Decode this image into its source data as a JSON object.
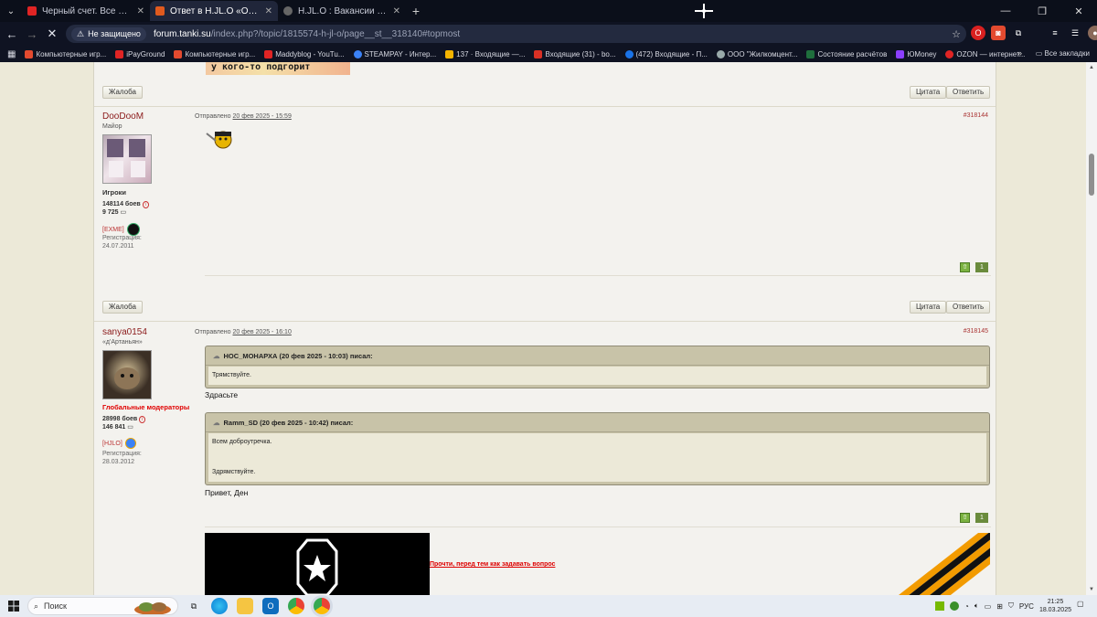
{
  "browser": {
    "tabs": [
      {
        "title": "Черный счет. Все серии. Фен...",
        "active": false,
        "favicon_color": "#e02424"
      },
      {
        "title": "Ответ в H.JL.O «Официальны...",
        "active": true,
        "favicon_color": "#e05a1e"
      },
      {
        "title": "H.JL.O : Вакансии кланов - О...",
        "active": false,
        "favicon_color": "#9aa"
      }
    ],
    "security_label": "Не защищено",
    "url_host": "forum.tanki.su",
    "url_path": "/index.php?/topic/1815574-h-jl-o/page__st__318140#topmost",
    "bookmarks": [
      {
        "label": "Компьютерные игр...",
        "color": "#e34a2f"
      },
      {
        "label": "iPayGround",
        "color": "#e02424"
      },
      {
        "label": "Компьютерные игр...",
        "color": "#e34a2f"
      },
      {
        "label": "Maddyblog - YouTu...",
        "color": "#e02424"
      },
      {
        "label": "STEAMPAY - Интер...",
        "color": "#3b82f6"
      },
      {
        "label": "137 · Входящие —...",
        "color": "#f5b400"
      },
      {
        "label": "Входящие (31) - bo...",
        "color": "#d93025"
      },
      {
        "label": "(472) Входящие - П...",
        "color": "#1a73e8"
      },
      {
        "label": "ООО \"Жилкомцент...",
        "color": "#9aa"
      },
      {
        "label": "Состояние расчётов",
        "color": "#1f6f3d"
      },
      {
        "label": "ЮMoney",
        "color": "#8b3ffd"
      },
      {
        "label": "OZON — интернет...",
        "color": "#e02424"
      }
    ],
    "all_bookmarks_label": "Все закладки"
  },
  "page": {
    "top_signature_text": "у кого-то подгорит",
    "report_label": "Жалоба",
    "quote_label": "Цитата",
    "reply_label": "Ответить",
    "posted_prefix": "Отправлено",
    "posts": [
      {
        "author": "DooDooM",
        "rank": "Майор",
        "group": "Игроки",
        "battles": "148114 боев",
        "score": "9 725",
        "clan": "[EXME]",
        "reg_label": "Регистрация:",
        "reg_date": "24.07.2011",
        "date": "20 фев 2025 - 15:59",
        "number": "#318144",
        "rep": "1"
      },
      {
        "author": "sanya0154",
        "rank": "«д'Артаньян»",
        "group": "Глобальные модераторы",
        "battles": "28998 боев",
        "score": "146 841",
        "clan": "[HJLO]",
        "reg_label": "Регистрация:",
        "reg_date": "28.03.2012",
        "date": "20 фев 2025 - 16:10",
        "number": "#318145",
        "rep": "1",
        "quotes": [
          {
            "header": "НОС_МОНАРХА (20 фев 2025 - 10:03) писал:",
            "body": "Трямствуйте."
          },
          {
            "header": "Ramm_SD (20 фев 2025 - 10:42) писал:",
            "body_lines": [
              "Всем доброутречка.",
              "Здрямствуйте."
            ]
          }
        ],
        "replies": [
          "Здрасьте",
          "Привет, Ден"
        ],
        "signature_link": "Прочти, перед тем как задавать вопрос"
      }
    ]
  },
  "taskbar": {
    "search_placeholder": "Поиск",
    "lang": "РУС",
    "time": "21:25",
    "date": "18.03.2025"
  },
  "colors": {
    "author": "#8b1a1a",
    "moderator_group": "#e00000",
    "quote_bg": "#c8c3a8",
    "rep_green": "#7bb241"
  }
}
